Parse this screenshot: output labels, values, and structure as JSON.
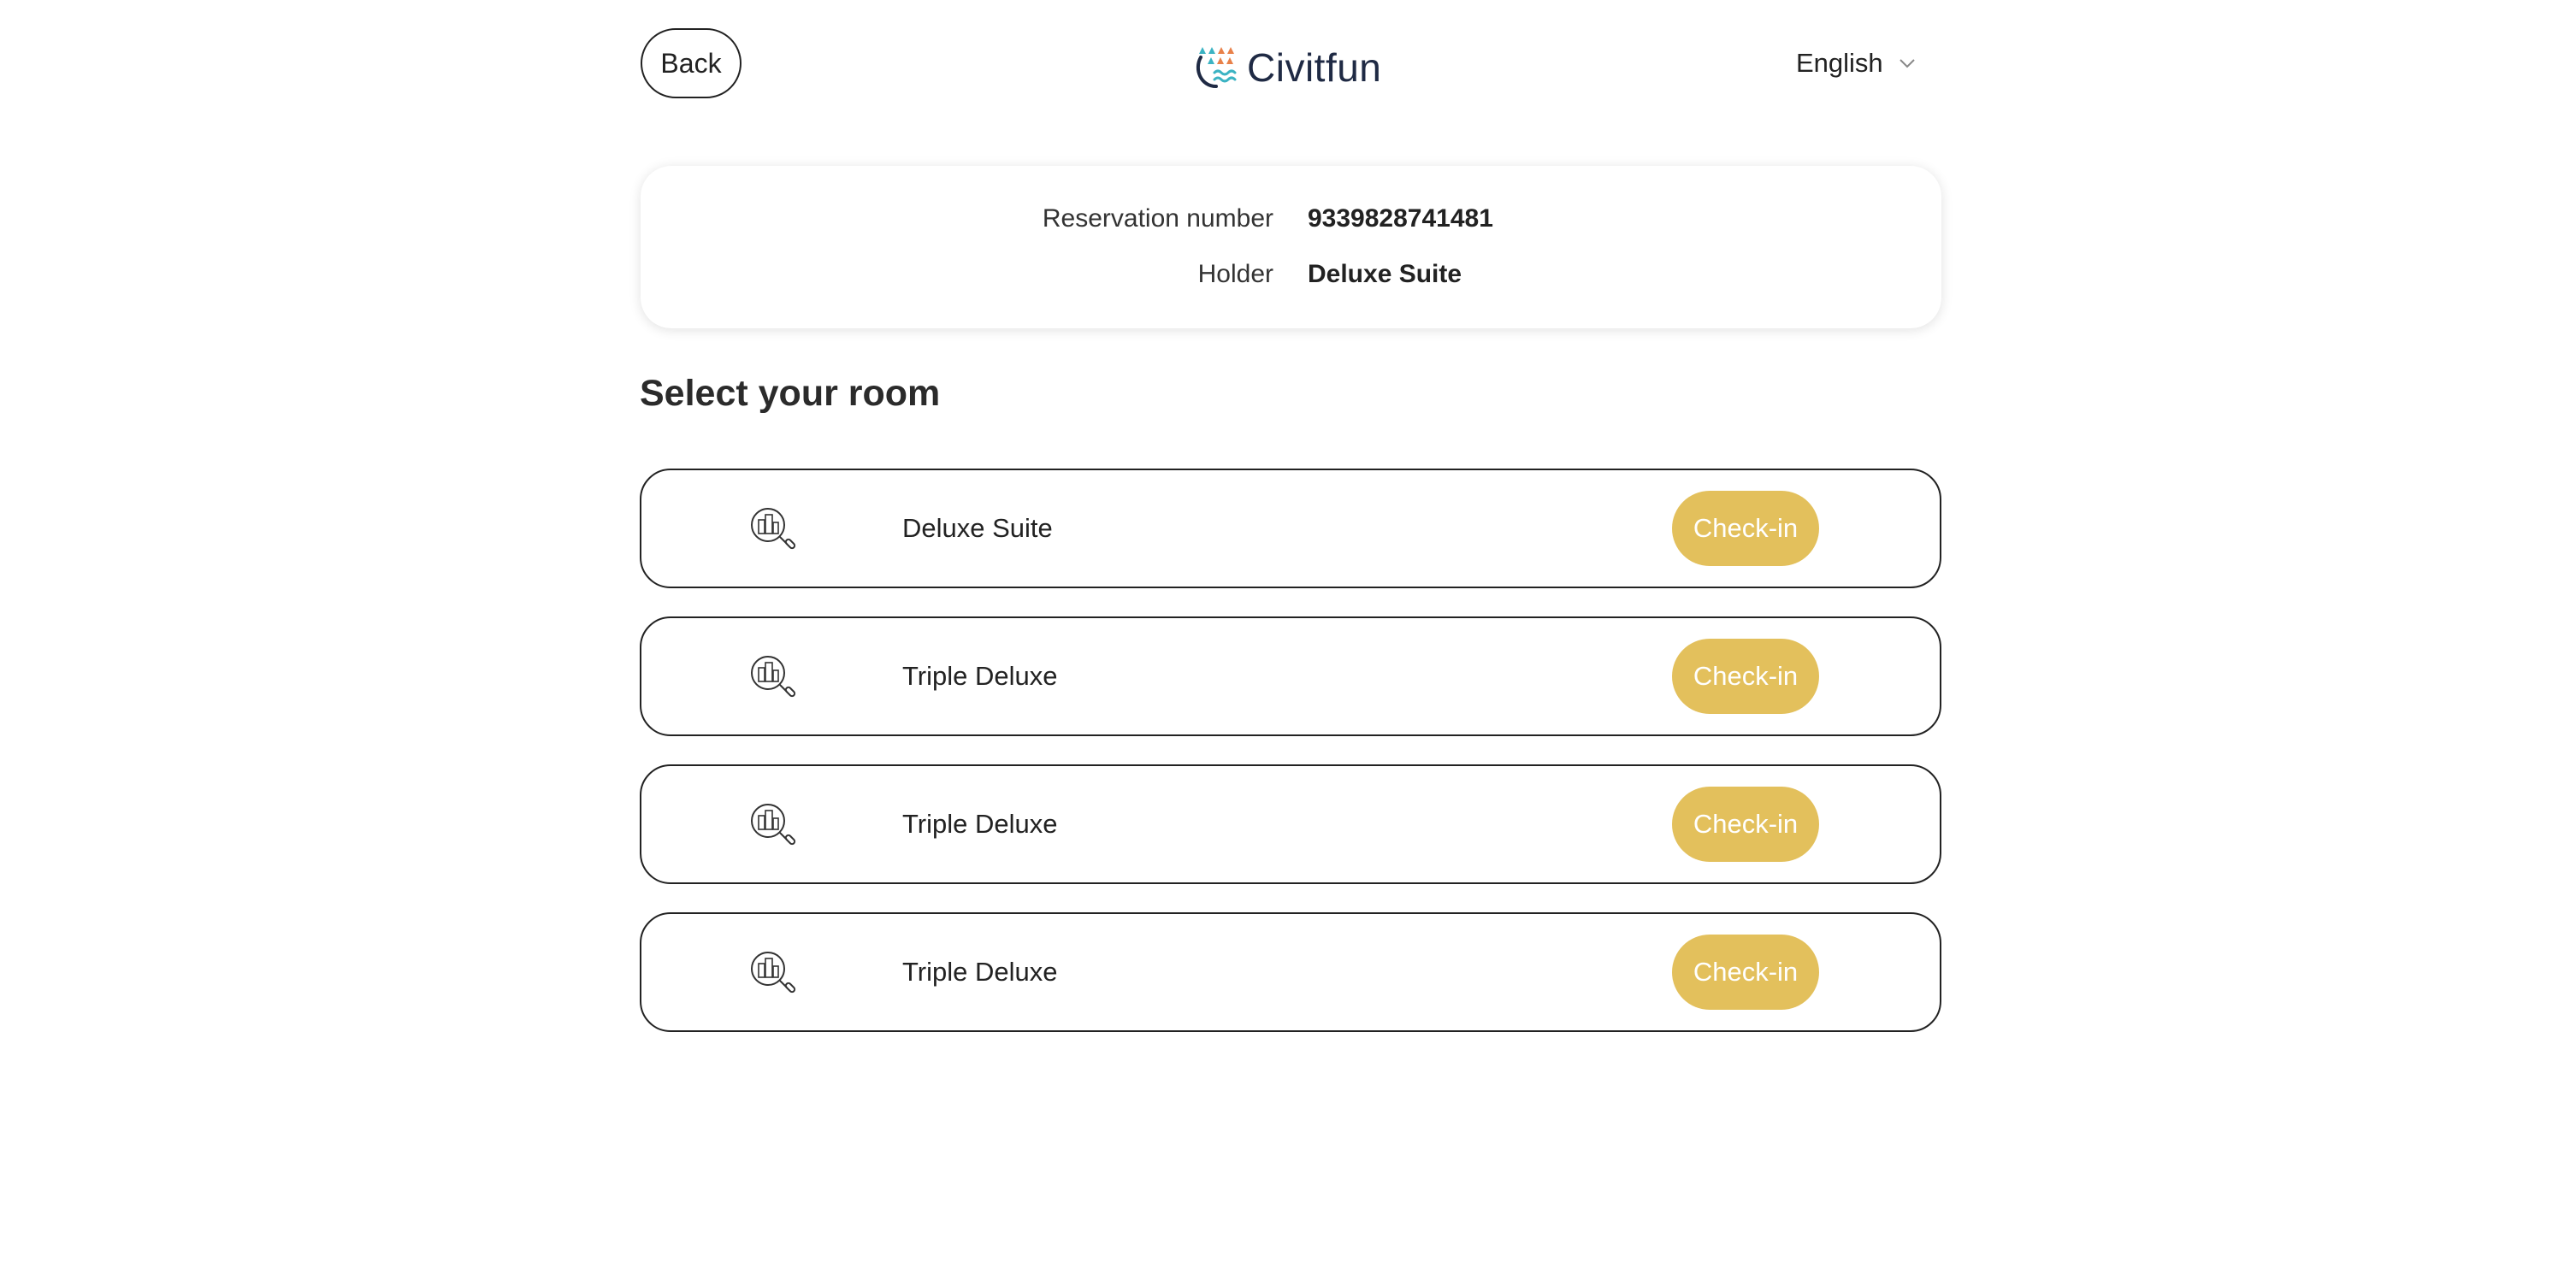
{
  "header": {
    "back_label": "Back",
    "brand_name": "Civitfun",
    "language": "English",
    "chevron_icon": "chevron-down-icon",
    "brand_colors": [
      "#3bb3c3",
      "#e8814a",
      "#1f2a44"
    ]
  },
  "reservation": {
    "number_label": "Reservation number",
    "number_value": "9339828741481",
    "holder_label": "Holder",
    "holder_value": "Deluxe Suite"
  },
  "section_title": "Select your room",
  "rooms": [
    {
      "name": "Deluxe Suite",
      "icon": "hotel-search-icon",
      "action_label": "Check-in"
    },
    {
      "name": "Triple Deluxe",
      "icon": "hotel-search-icon",
      "action_label": "Check-in"
    },
    {
      "name": "Triple Deluxe",
      "icon": "hotel-search-icon",
      "action_label": "Check-in"
    },
    {
      "name": "Triple Deluxe",
      "icon": "hotel-search-icon",
      "action_label": "Check-in"
    }
  ],
  "colors": {
    "accent": "#e3c05c",
    "text": "#222222",
    "background": "#ffffff"
  }
}
